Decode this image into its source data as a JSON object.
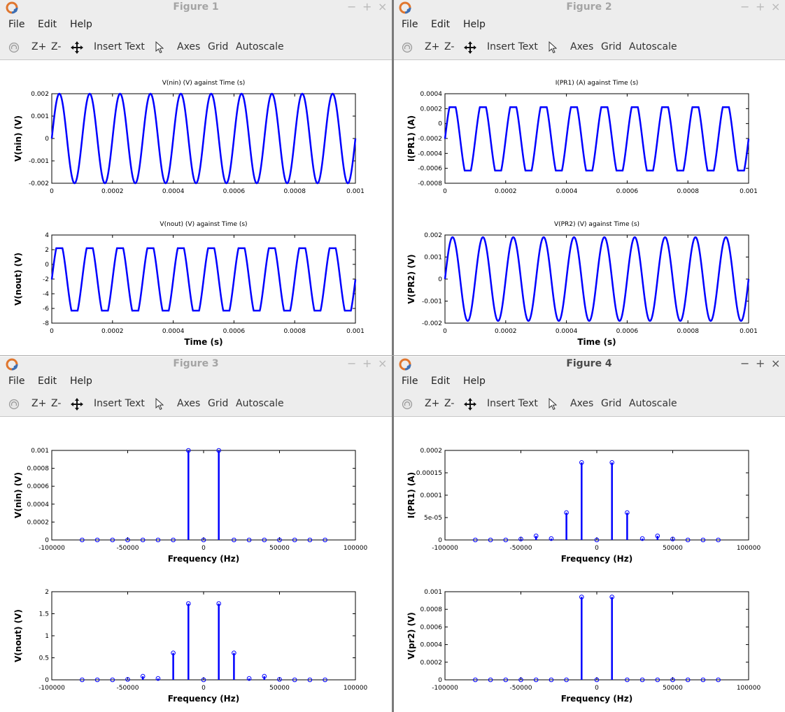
{
  "menu": [
    "File",
    "Edit",
    "Help"
  ],
  "toolbar": {
    "zoom_in": "Z+",
    "zoom_out": "Z-",
    "insert_text": "Insert Text",
    "axes": "Axes",
    "grid": "Grid",
    "autoscale": "Autoscale"
  },
  "window_buttons": {
    "minimize": "−",
    "maximize": "+",
    "close": "×"
  },
  "colors": {
    "line": "#0000ff",
    "inactive_title": "#a4a4a4",
    "active_title": "#4a4a4a"
  },
  "windows": [
    {
      "title": "Figure 1",
      "active": false,
      "chart_data": [
        {
          "type": "line",
          "title": "V(nin) (V) against Time (s)",
          "xlabel": "",
          "ylabel": "V(nin) (V)",
          "xlim": [
            0,
            0.001
          ],
          "ylim": [
            -0.002,
            0.002
          ],
          "xticks": [
            "0",
            "0.0002",
            "0.0004",
            "0.0006",
            "0.0008",
            "0.001"
          ],
          "yticks": [
            "-0.002",
            "-0.001",
            "0",
            "0.001",
            "0.002"
          ],
          "signal": {
            "kind": "sine",
            "amplitude": 0.002,
            "frequency": 10000
          }
        },
        {
          "type": "line",
          "title": "V(nout) (V) against Time (s)",
          "xlabel": "Time (s)",
          "ylabel": "V(nout) (V)",
          "xlim": [
            0,
            0.001
          ],
          "ylim": [
            -8,
            4
          ],
          "xticks": [
            "0",
            "0.0002",
            "0.0004",
            "0.0006",
            "0.0008",
            "0.001"
          ],
          "yticks": [
            "-8",
            "-6",
            "-4",
            "-2",
            "0",
            "2",
            "4"
          ],
          "signal": {
            "kind": "clipped",
            "frequency": 10000,
            "max": 2.2,
            "min": -6.3
          }
        }
      ]
    },
    {
      "title": "Figure 2",
      "active": false,
      "chart_data": [
        {
          "type": "line",
          "title": "I(PR1) (A) against Time (s)",
          "xlabel": "",
          "ylabel": "I(PR1) (A)",
          "xlim": [
            0,
            0.001
          ],
          "ylim": [
            -0.0008,
            0.0004
          ],
          "xticks": [
            "0",
            "0.0002",
            "0.0004",
            "0.0006",
            "0.0008",
            "0.001"
          ],
          "yticks": [
            "-0.0008",
            "-0.0006",
            "-0.0004",
            "-0.0002",
            "0",
            "0.0002",
            "0.0004"
          ],
          "signal": {
            "kind": "clipped",
            "frequency": 10000,
            "max": 0.00022,
            "min": -0.00063
          }
        },
        {
          "type": "line",
          "title": "V(PR2) (V) against Time (s)",
          "xlabel": "Time (s)",
          "ylabel": "V(PR2) (V)",
          "xlim": [
            0,
            0.001
          ],
          "ylim": [
            -0.002,
            0.002
          ],
          "xticks": [
            "0",
            "0.0002",
            "0.0004",
            "0.0006",
            "0.0008",
            "0.001"
          ],
          "yticks": [
            "-0.002",
            "-0.001",
            "0",
            "0.001",
            "0.002"
          ],
          "signal": {
            "kind": "sine",
            "amplitude": 0.0019,
            "frequency": 10000
          }
        }
      ]
    },
    {
      "title": "Figure 3",
      "active": false,
      "chart_data": [
        {
          "type": "stem",
          "title": "",
          "xlabel": "Frequency (Hz)",
          "ylabel": "V(nin) (V)",
          "xlim": [
            -100000,
            100000
          ],
          "ylim": [
            0,
            0.001
          ],
          "xticks": [
            "-100000",
            "-50000",
            "0",
            "50000",
            "100000"
          ],
          "yticks": [
            "0",
            "0.0002",
            "0.0004",
            "0.0006",
            "0.0008",
            "0.001"
          ],
          "x": [
            -80000,
            -70000,
            -60000,
            -50000,
            -40000,
            -30000,
            -20000,
            -10000,
            0,
            10000,
            20000,
            30000,
            40000,
            50000,
            60000,
            70000,
            80000
          ],
          "y": [
            0,
            0,
            0,
            0,
            0,
            0,
            0,
            0.001,
            0,
            0.001,
            0,
            0,
            0,
            0,
            0,
            0,
            0
          ]
        },
        {
          "type": "stem",
          "title": "",
          "xlabel": "Frequency (Hz)",
          "ylabel": "V(nout) (V)",
          "xlim": [
            -100000,
            100000
          ],
          "ylim": [
            0,
            2
          ],
          "xticks": [
            "-100000",
            "-50000",
            "0",
            "50000",
            "100000"
          ],
          "yticks": [
            "0",
            "0.5",
            "1",
            "1.5",
            "2"
          ],
          "x": [
            -80000,
            -70000,
            -60000,
            -50000,
            -40000,
            -30000,
            -20000,
            -10000,
            0,
            10000,
            20000,
            30000,
            40000,
            50000,
            60000,
            70000,
            80000
          ],
          "y": [
            0,
            0,
            0,
            0.01,
            0.08,
            0.03,
            0.61,
            1.73,
            0,
            1.73,
            0.61,
            0.03,
            0.08,
            0.01,
            0,
            0,
            0
          ]
        }
      ]
    },
    {
      "title": "Figure 4",
      "active": true,
      "chart_data": [
        {
          "type": "stem",
          "title": "",
          "xlabel": "Frequency (Hz)",
          "ylabel": "I(PR1) (A)",
          "xlim": [
            -100000,
            100000
          ],
          "ylim": [
            0,
            0.0002
          ],
          "xticks": [
            "-100000",
            "-50000",
            "0",
            "50000",
            "100000"
          ],
          "yticks": [
            "0",
            "5e-05",
            "0.0001",
            "0.00015",
            "0.0002"
          ],
          "x": [
            -80000,
            -70000,
            -60000,
            -50000,
            -40000,
            -30000,
            -20000,
            -10000,
            0,
            10000,
            20000,
            30000,
            40000,
            50000,
            60000,
            70000,
            80000
          ],
          "y": [
            0,
            0,
            0,
            2e-06,
            9e-06,
            3e-06,
            6.1e-05,
            0.000173,
            0,
            0.000173,
            6.1e-05,
            3e-06,
            9e-06,
            2e-06,
            0,
            0,
            0
          ]
        },
        {
          "type": "stem",
          "title": "",
          "xlabel": "Frequency (Hz)",
          "ylabel": "V(pr2) (V)",
          "xlim": [
            -100000,
            100000
          ],
          "ylim": [
            0,
            0.001
          ],
          "xticks": [
            "-100000",
            "-50000",
            "0",
            "50000",
            "100000"
          ],
          "yticks": [
            "0",
            "0.0002",
            "0.0004",
            "0.0006",
            "0.0008",
            "0.001"
          ],
          "x": [
            -80000,
            -70000,
            -60000,
            -50000,
            -40000,
            -30000,
            -20000,
            -10000,
            0,
            10000,
            20000,
            30000,
            40000,
            50000,
            60000,
            70000,
            80000
          ],
          "y": [
            0,
            0,
            0,
            0,
            0,
            0,
            0,
            0.00094,
            0,
            0.00094,
            0,
            0,
            0,
            0,
            0,
            0,
            0
          ]
        }
      ]
    }
  ]
}
